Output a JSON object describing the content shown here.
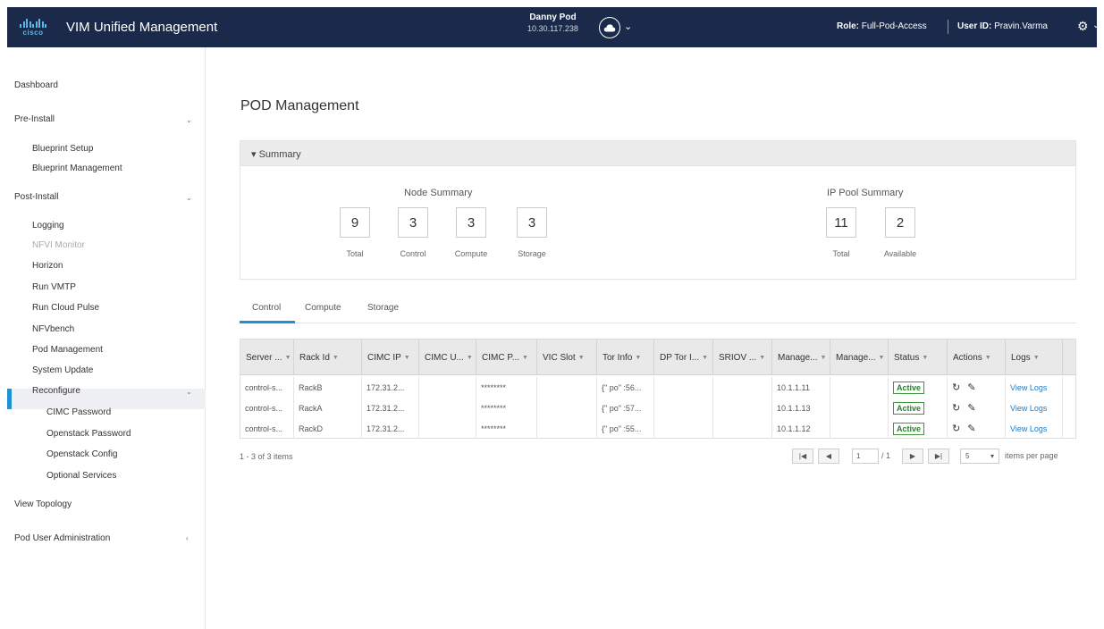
{
  "header": {
    "logo_text": "cisco",
    "app_title": "VIM Unified Management",
    "pod_name": "Danny Pod",
    "pod_ip": "10.30.117.238",
    "role_label": "Role:",
    "role_value": "Full-Pod-Access",
    "user_label": "User ID:",
    "user_value": "Pravin.Varma",
    "bar_color": "#1b2a4a",
    "accent_color": "#1e90d6"
  },
  "sidebar": {
    "items": [
      {
        "label": "Dashboard"
      },
      {
        "label": "Pre-Install"
      },
      {
        "label": "Blueprint Setup"
      },
      {
        "label": "Blueprint Management"
      },
      {
        "label": "Post-Install"
      },
      {
        "label": "Logging"
      },
      {
        "label": "NFVI Monitor"
      },
      {
        "label": "Horizon"
      },
      {
        "label": "Run VMTP"
      },
      {
        "label": "Run Cloud Pulse"
      },
      {
        "label": "NFVbench"
      },
      {
        "label": "Pod Management"
      },
      {
        "label": "System Update"
      },
      {
        "label": "Reconfigure"
      },
      {
        "label": "CIMC Password"
      },
      {
        "label": "Openstack Password"
      },
      {
        "label": "Openstack Config"
      },
      {
        "label": "Optional Services"
      },
      {
        "label": "View Topology"
      },
      {
        "label": "Pod User Administration"
      }
    ],
    "active_item": "Pod Management"
  },
  "main": {
    "title": "POD Management",
    "summary": {
      "header": "Summary",
      "node_title": "Node Summary",
      "node": [
        {
          "value": "9",
          "label": "Total"
        },
        {
          "value": "3",
          "label": "Control"
        },
        {
          "value": "3",
          "label": "Compute"
        },
        {
          "value": "3",
          "label": "Storage"
        }
      ],
      "ip_title": "IP Pool Summary",
      "ip": [
        {
          "value": "11",
          "label": "Total"
        },
        {
          "value": "2",
          "label": "Available"
        }
      ]
    },
    "tabs": [
      {
        "label": "Control"
      },
      {
        "label": "Compute"
      },
      {
        "label": "Storage"
      }
    ],
    "active_tab": "Control",
    "table": {
      "columns": [
        "Server ...",
        "Rack Id",
        "CIMC IP",
        "CIMC U...",
        "CIMC P...",
        "VIC Slot",
        "Tor Info",
        "DP Tor I...",
        "SRIOV ...",
        "Manage...",
        "Manage...",
        "Status",
        "Actions",
        "Logs"
      ],
      "rows": [
        {
          "server": "control-s...",
          "rack": "RackB",
          "cimc_ip": "172.31.2...",
          "cimc_u": "",
          "cimc_p": "********",
          "vic": "",
          "tor": "{\" po\" :56...",
          "dp": "",
          "sriov": "",
          "mgmt1": "10.1.1.11",
          "mgmt2": "",
          "status": "Active",
          "logs": "View Logs"
        },
        {
          "server": "control-s...",
          "rack": "RackA",
          "cimc_ip": "172.31.2...",
          "cimc_u": "",
          "cimc_p": "********",
          "vic": "",
          "tor": "{\" po\" :57...",
          "dp": "",
          "sriov": "",
          "mgmt1": "10.1.1.13",
          "mgmt2": "",
          "status": "Active",
          "logs": "View Logs"
        },
        {
          "server": "control-s...",
          "rack": "RackD",
          "cimc_ip": "172.31.2...",
          "cimc_u": "",
          "cimc_p": "********",
          "vic": "",
          "tor": "{\" po\" :55...",
          "dp": "",
          "sriov": "",
          "mgmt1": "10.1.1.12",
          "mgmt2": "",
          "status": "Active",
          "logs": "View Logs"
        }
      ]
    },
    "pager": {
      "info": "1 - 3 of 3 items",
      "current_page": "1",
      "page_of": "/ 1",
      "page_size": "5",
      "items_per_page": "items per page"
    }
  }
}
